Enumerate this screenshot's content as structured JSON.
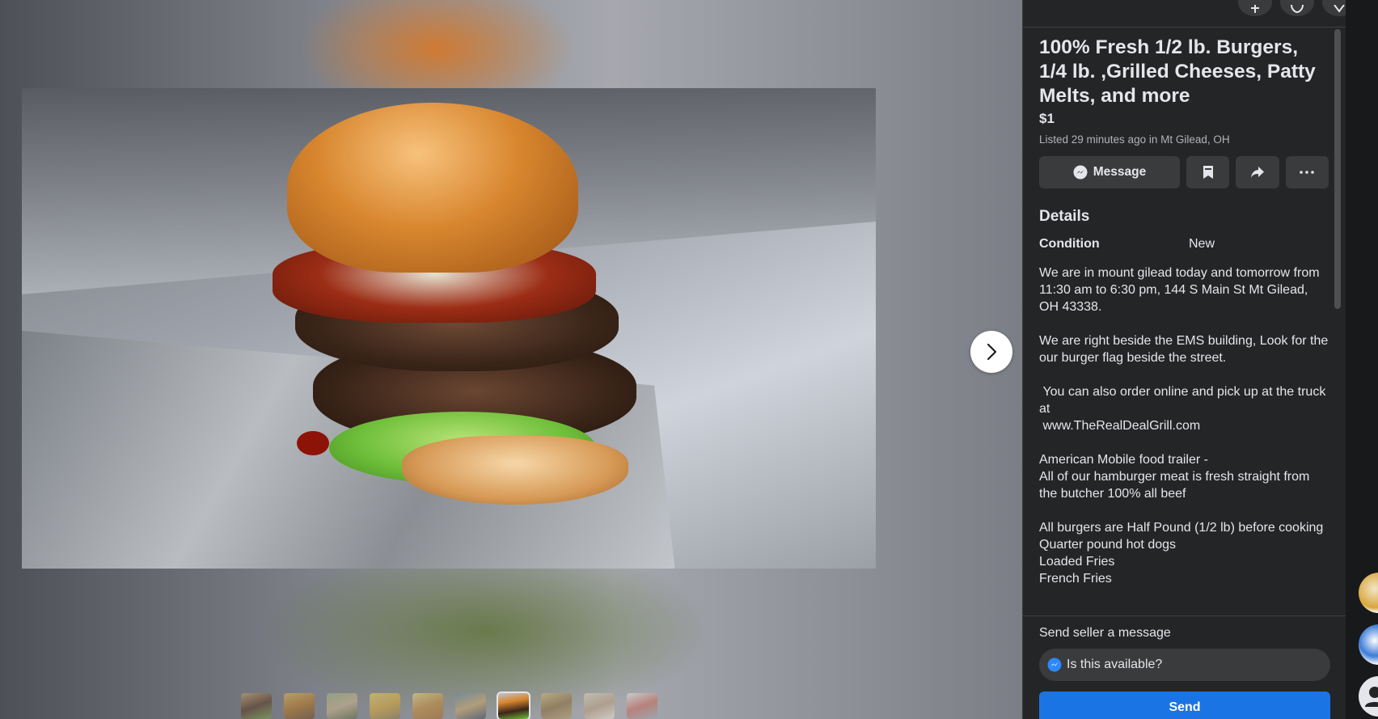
{
  "listing": {
    "title": "100% Fresh 1/2 lb. Burgers, 1/4 lb. ,Grilled Cheeses, Patty Melts, and more",
    "price": "$1",
    "listed": "Listed 29 minutes ago in Mt Gilead, OH"
  },
  "actions": {
    "message_label": "Message"
  },
  "details": {
    "heading": "Details",
    "condition_key": "Condition",
    "condition_value": "New",
    "description": [
      "We are in mount gilead today and tomorrow from 11:30 am to 6:30 pm, 144 S Main St Mt Gilead, OH 43338.",
      "We are right beside the EMS building, Look for the our burger flag beside the street.",
      " You can also order online and pick up at the truck at",
      " www.TheRealDealGrill.com",
      "American Mobile food trailer -",
      "All of our hamburger meat is fresh straight from the butcher 100% all beef",
      "All burgers are Half Pound (1/2 lb) before cooking",
      "Quarter pound hot dogs",
      "Loaded Fries",
      "French Fries"
    ]
  },
  "send": {
    "label": "Send seller a message",
    "input_value": "Is this available?",
    "button_label": "Send"
  },
  "colors": {
    "panel_bg": "#242526",
    "button_bg": "#3a3b3c",
    "accent_blue": "#1b74e4",
    "text_primary": "#e4e6eb",
    "text_secondary": "#b0b3b8"
  },
  "icons": [
    "messenger-icon",
    "bookmark-icon",
    "share-icon",
    "more-icon",
    "chevron-right-icon",
    "plus-icon",
    "notifications-icon"
  ],
  "gallery": {
    "photo_count": 10,
    "active_index": 6
  }
}
